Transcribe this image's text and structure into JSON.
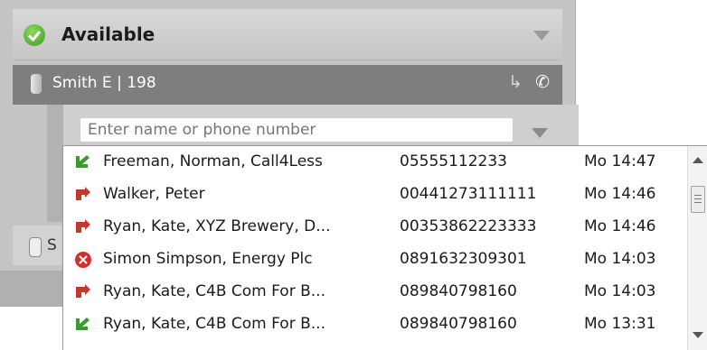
{
  "status": {
    "label": "Available"
  },
  "line": {
    "label": "Smith E | 198"
  },
  "dial": {
    "placeholder": "Enter name or phone number"
  },
  "second_line": {
    "label": "S"
  },
  "calls": [
    {
      "name": "Freeman, Norman, Call4Less",
      "number": "05555112233",
      "time": "Mo 14:47",
      "type": "incoming"
    },
    {
      "name": "Walker, Peter",
      "number": "00441273111111",
      "time": "Mo 14:46",
      "type": "outgoing"
    },
    {
      "name": "Ryan, Kate, XYZ Brewery, D...",
      "number": "00353862223333",
      "time": "Mo 14:46",
      "type": "outgoing"
    },
    {
      "name": "Simon Simpson, Energy Plc",
      "number": "0891632309301",
      "time": "Mo 14:03",
      "type": "missed"
    },
    {
      "name": "Ryan, Kate, C4B Com For B...",
      "number": "089840798160",
      "time": "Mo 14:03",
      "type": "outgoing"
    },
    {
      "name": "Ryan, Kate, C4B Com For B...",
      "number": "089840798160",
      "time": "Mo 13:31",
      "type": "incoming"
    }
  ],
  "colors": {
    "incoming": "#3a9c2c",
    "outgoing": "#c0392b",
    "missed": "#d32f2f"
  }
}
